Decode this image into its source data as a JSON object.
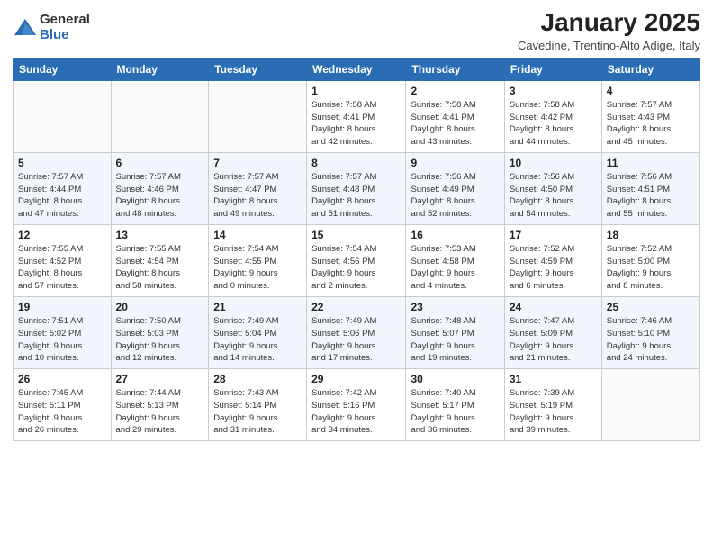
{
  "logo": {
    "general": "General",
    "blue": "Blue"
  },
  "title": "January 2025",
  "location": "Cavedine, Trentino-Alto Adige, Italy",
  "days_of_week": [
    "Sunday",
    "Monday",
    "Tuesday",
    "Wednesday",
    "Thursday",
    "Friday",
    "Saturday"
  ],
  "weeks": [
    [
      {
        "day": "",
        "info": ""
      },
      {
        "day": "",
        "info": ""
      },
      {
        "day": "",
        "info": ""
      },
      {
        "day": "1",
        "info": "Sunrise: 7:58 AM\nSunset: 4:41 PM\nDaylight: 8 hours\nand 42 minutes."
      },
      {
        "day": "2",
        "info": "Sunrise: 7:58 AM\nSunset: 4:41 PM\nDaylight: 8 hours\nand 43 minutes."
      },
      {
        "day": "3",
        "info": "Sunrise: 7:58 AM\nSunset: 4:42 PM\nDaylight: 8 hours\nand 44 minutes."
      },
      {
        "day": "4",
        "info": "Sunrise: 7:57 AM\nSunset: 4:43 PM\nDaylight: 8 hours\nand 45 minutes."
      }
    ],
    [
      {
        "day": "5",
        "info": "Sunrise: 7:57 AM\nSunset: 4:44 PM\nDaylight: 8 hours\nand 47 minutes."
      },
      {
        "day": "6",
        "info": "Sunrise: 7:57 AM\nSunset: 4:46 PM\nDaylight: 8 hours\nand 48 minutes."
      },
      {
        "day": "7",
        "info": "Sunrise: 7:57 AM\nSunset: 4:47 PM\nDaylight: 8 hours\nand 49 minutes."
      },
      {
        "day": "8",
        "info": "Sunrise: 7:57 AM\nSunset: 4:48 PM\nDaylight: 8 hours\nand 51 minutes."
      },
      {
        "day": "9",
        "info": "Sunrise: 7:56 AM\nSunset: 4:49 PM\nDaylight: 8 hours\nand 52 minutes."
      },
      {
        "day": "10",
        "info": "Sunrise: 7:56 AM\nSunset: 4:50 PM\nDaylight: 8 hours\nand 54 minutes."
      },
      {
        "day": "11",
        "info": "Sunrise: 7:56 AM\nSunset: 4:51 PM\nDaylight: 8 hours\nand 55 minutes."
      }
    ],
    [
      {
        "day": "12",
        "info": "Sunrise: 7:55 AM\nSunset: 4:52 PM\nDaylight: 8 hours\nand 57 minutes."
      },
      {
        "day": "13",
        "info": "Sunrise: 7:55 AM\nSunset: 4:54 PM\nDaylight: 8 hours\nand 58 minutes."
      },
      {
        "day": "14",
        "info": "Sunrise: 7:54 AM\nSunset: 4:55 PM\nDaylight: 9 hours\nand 0 minutes."
      },
      {
        "day": "15",
        "info": "Sunrise: 7:54 AM\nSunset: 4:56 PM\nDaylight: 9 hours\nand 2 minutes."
      },
      {
        "day": "16",
        "info": "Sunrise: 7:53 AM\nSunset: 4:58 PM\nDaylight: 9 hours\nand 4 minutes."
      },
      {
        "day": "17",
        "info": "Sunrise: 7:52 AM\nSunset: 4:59 PM\nDaylight: 9 hours\nand 6 minutes."
      },
      {
        "day": "18",
        "info": "Sunrise: 7:52 AM\nSunset: 5:00 PM\nDaylight: 9 hours\nand 8 minutes."
      }
    ],
    [
      {
        "day": "19",
        "info": "Sunrise: 7:51 AM\nSunset: 5:02 PM\nDaylight: 9 hours\nand 10 minutes."
      },
      {
        "day": "20",
        "info": "Sunrise: 7:50 AM\nSunset: 5:03 PM\nDaylight: 9 hours\nand 12 minutes."
      },
      {
        "day": "21",
        "info": "Sunrise: 7:49 AM\nSunset: 5:04 PM\nDaylight: 9 hours\nand 14 minutes."
      },
      {
        "day": "22",
        "info": "Sunrise: 7:49 AM\nSunset: 5:06 PM\nDaylight: 9 hours\nand 17 minutes."
      },
      {
        "day": "23",
        "info": "Sunrise: 7:48 AM\nSunset: 5:07 PM\nDaylight: 9 hours\nand 19 minutes."
      },
      {
        "day": "24",
        "info": "Sunrise: 7:47 AM\nSunset: 5:09 PM\nDaylight: 9 hours\nand 21 minutes."
      },
      {
        "day": "25",
        "info": "Sunrise: 7:46 AM\nSunset: 5:10 PM\nDaylight: 9 hours\nand 24 minutes."
      }
    ],
    [
      {
        "day": "26",
        "info": "Sunrise: 7:45 AM\nSunset: 5:11 PM\nDaylight: 9 hours\nand 26 minutes."
      },
      {
        "day": "27",
        "info": "Sunrise: 7:44 AM\nSunset: 5:13 PM\nDaylight: 9 hours\nand 29 minutes."
      },
      {
        "day": "28",
        "info": "Sunrise: 7:43 AM\nSunset: 5:14 PM\nDaylight: 9 hours\nand 31 minutes."
      },
      {
        "day": "29",
        "info": "Sunrise: 7:42 AM\nSunset: 5:16 PM\nDaylight: 9 hours\nand 34 minutes."
      },
      {
        "day": "30",
        "info": "Sunrise: 7:40 AM\nSunset: 5:17 PM\nDaylight: 9 hours\nand 36 minutes."
      },
      {
        "day": "31",
        "info": "Sunrise: 7:39 AM\nSunset: 5:19 PM\nDaylight: 9 hours\nand 39 minutes."
      },
      {
        "day": "",
        "info": ""
      }
    ]
  ]
}
